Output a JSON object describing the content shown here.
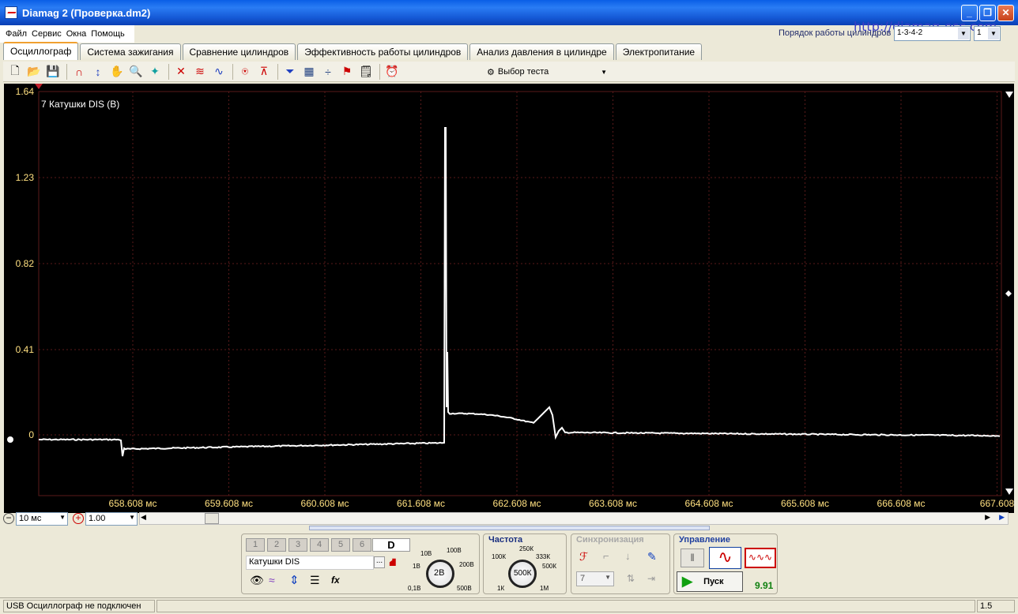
{
  "window": {
    "title": "Diamag 2 (Проверка.dm2)"
  },
  "menu": [
    "Файл",
    "Сервис",
    "Окна",
    "Помощь"
  ],
  "header": {
    "firing_order_label": "Порядок работы цилиндров",
    "url": "http://diamag-osc.com",
    "firing_order_value": "1-3-4-2",
    "cylinder_value": "1"
  },
  "tabs": [
    "Осциллограф",
    "Система зажигания",
    "Сравнение цилиндров",
    "Эффективность работы цилиндров",
    "Анализ давления в цилиндре",
    "Электропитание"
  ],
  "toolbar": {
    "test_select": "Выбор теста"
  },
  "scope": {
    "channel_label": "7 Катушки DIS (В)",
    "y_ticks": [
      "1.64",
      "1.23",
      "0.82",
      "0.41",
      "0"
    ],
    "x_ticks": [
      "658.608 мс",
      "659.608 мс",
      "660.608 мс",
      "661.608 мс",
      "662.608 мс",
      "663.608 мс",
      "664.608 мс",
      "665.608 мс",
      "666.608 мс",
      "667.608"
    ],
    "colors": {
      "bg": "#000000",
      "trace": "#ffffff",
      "grid": "#5a1a1a",
      "label": "#ffe080"
    }
  },
  "scale": {
    "time_div": "10 мс",
    "zoom": "1.00"
  },
  "channel_panel": {
    "channels": [
      "1",
      "2",
      "3",
      "4",
      "5",
      "6",
      "D"
    ],
    "sensor": "Катушки DIS",
    "dots": "...",
    "knob_value": "2В",
    "knob_labels": [
      "10В",
      "100В",
      "1В",
      "200В",
      "0,1В",
      "500В"
    ]
  },
  "freq_panel": {
    "title": "Частота",
    "knob_value": "500К",
    "labels": [
      "250К",
      "100К",
      "333К",
      "500К",
      "1К",
      "1М"
    ]
  },
  "sync_panel": {
    "title": "Синхронизация",
    "channel": "7"
  },
  "control_panel": {
    "title": "Управление",
    "start": "Пуск",
    "value": "9.91"
  },
  "status": {
    "usb": "USB Осциллограф не подключен",
    "right": "1.5"
  }
}
